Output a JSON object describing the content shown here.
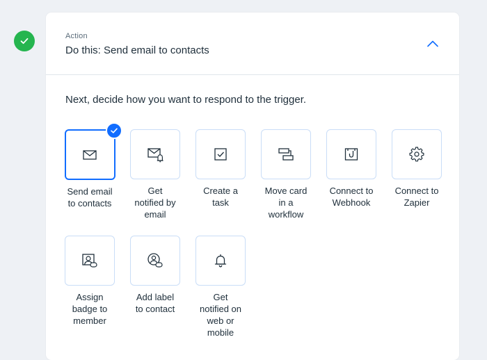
{
  "step": {
    "status_icon": "check-circle-icon",
    "status_color": "#25b54f"
  },
  "action_panel": {
    "caption": "Action",
    "title": "Do this: Send email to contacts",
    "collapse_icon": "chevron-up-icon",
    "prompt": "Next, decide how you want to respond to the trigger.",
    "accent_color": "#116dff",
    "options": [
      {
        "label": "Send email\nto contacts",
        "icon": "envelope-icon",
        "selected": true
      },
      {
        "label": "Get\nnotified by\nemail",
        "icon": "email-notification-icon",
        "selected": false
      },
      {
        "label": "Create a\ntask",
        "icon": "checkbox-icon",
        "selected": false
      },
      {
        "label": "Move card\nin a\nworkflow",
        "icon": "workflow-cards-icon",
        "selected": false
      },
      {
        "label": "Connect to\nWebhook",
        "icon": "webhook-icon",
        "selected": false
      },
      {
        "label": "Connect to\nZapier",
        "icon": "gear-icon",
        "selected": false
      },
      {
        "label": "Assign\nbadge to\nmember",
        "icon": "badge-icon",
        "selected": false
      },
      {
        "label": "Add label\nto contact",
        "icon": "contact-label-icon",
        "selected": false
      },
      {
        "label": "Get\nnotified on\nweb or\nmobile",
        "icon": "bell-icon",
        "selected": false
      }
    ]
  }
}
